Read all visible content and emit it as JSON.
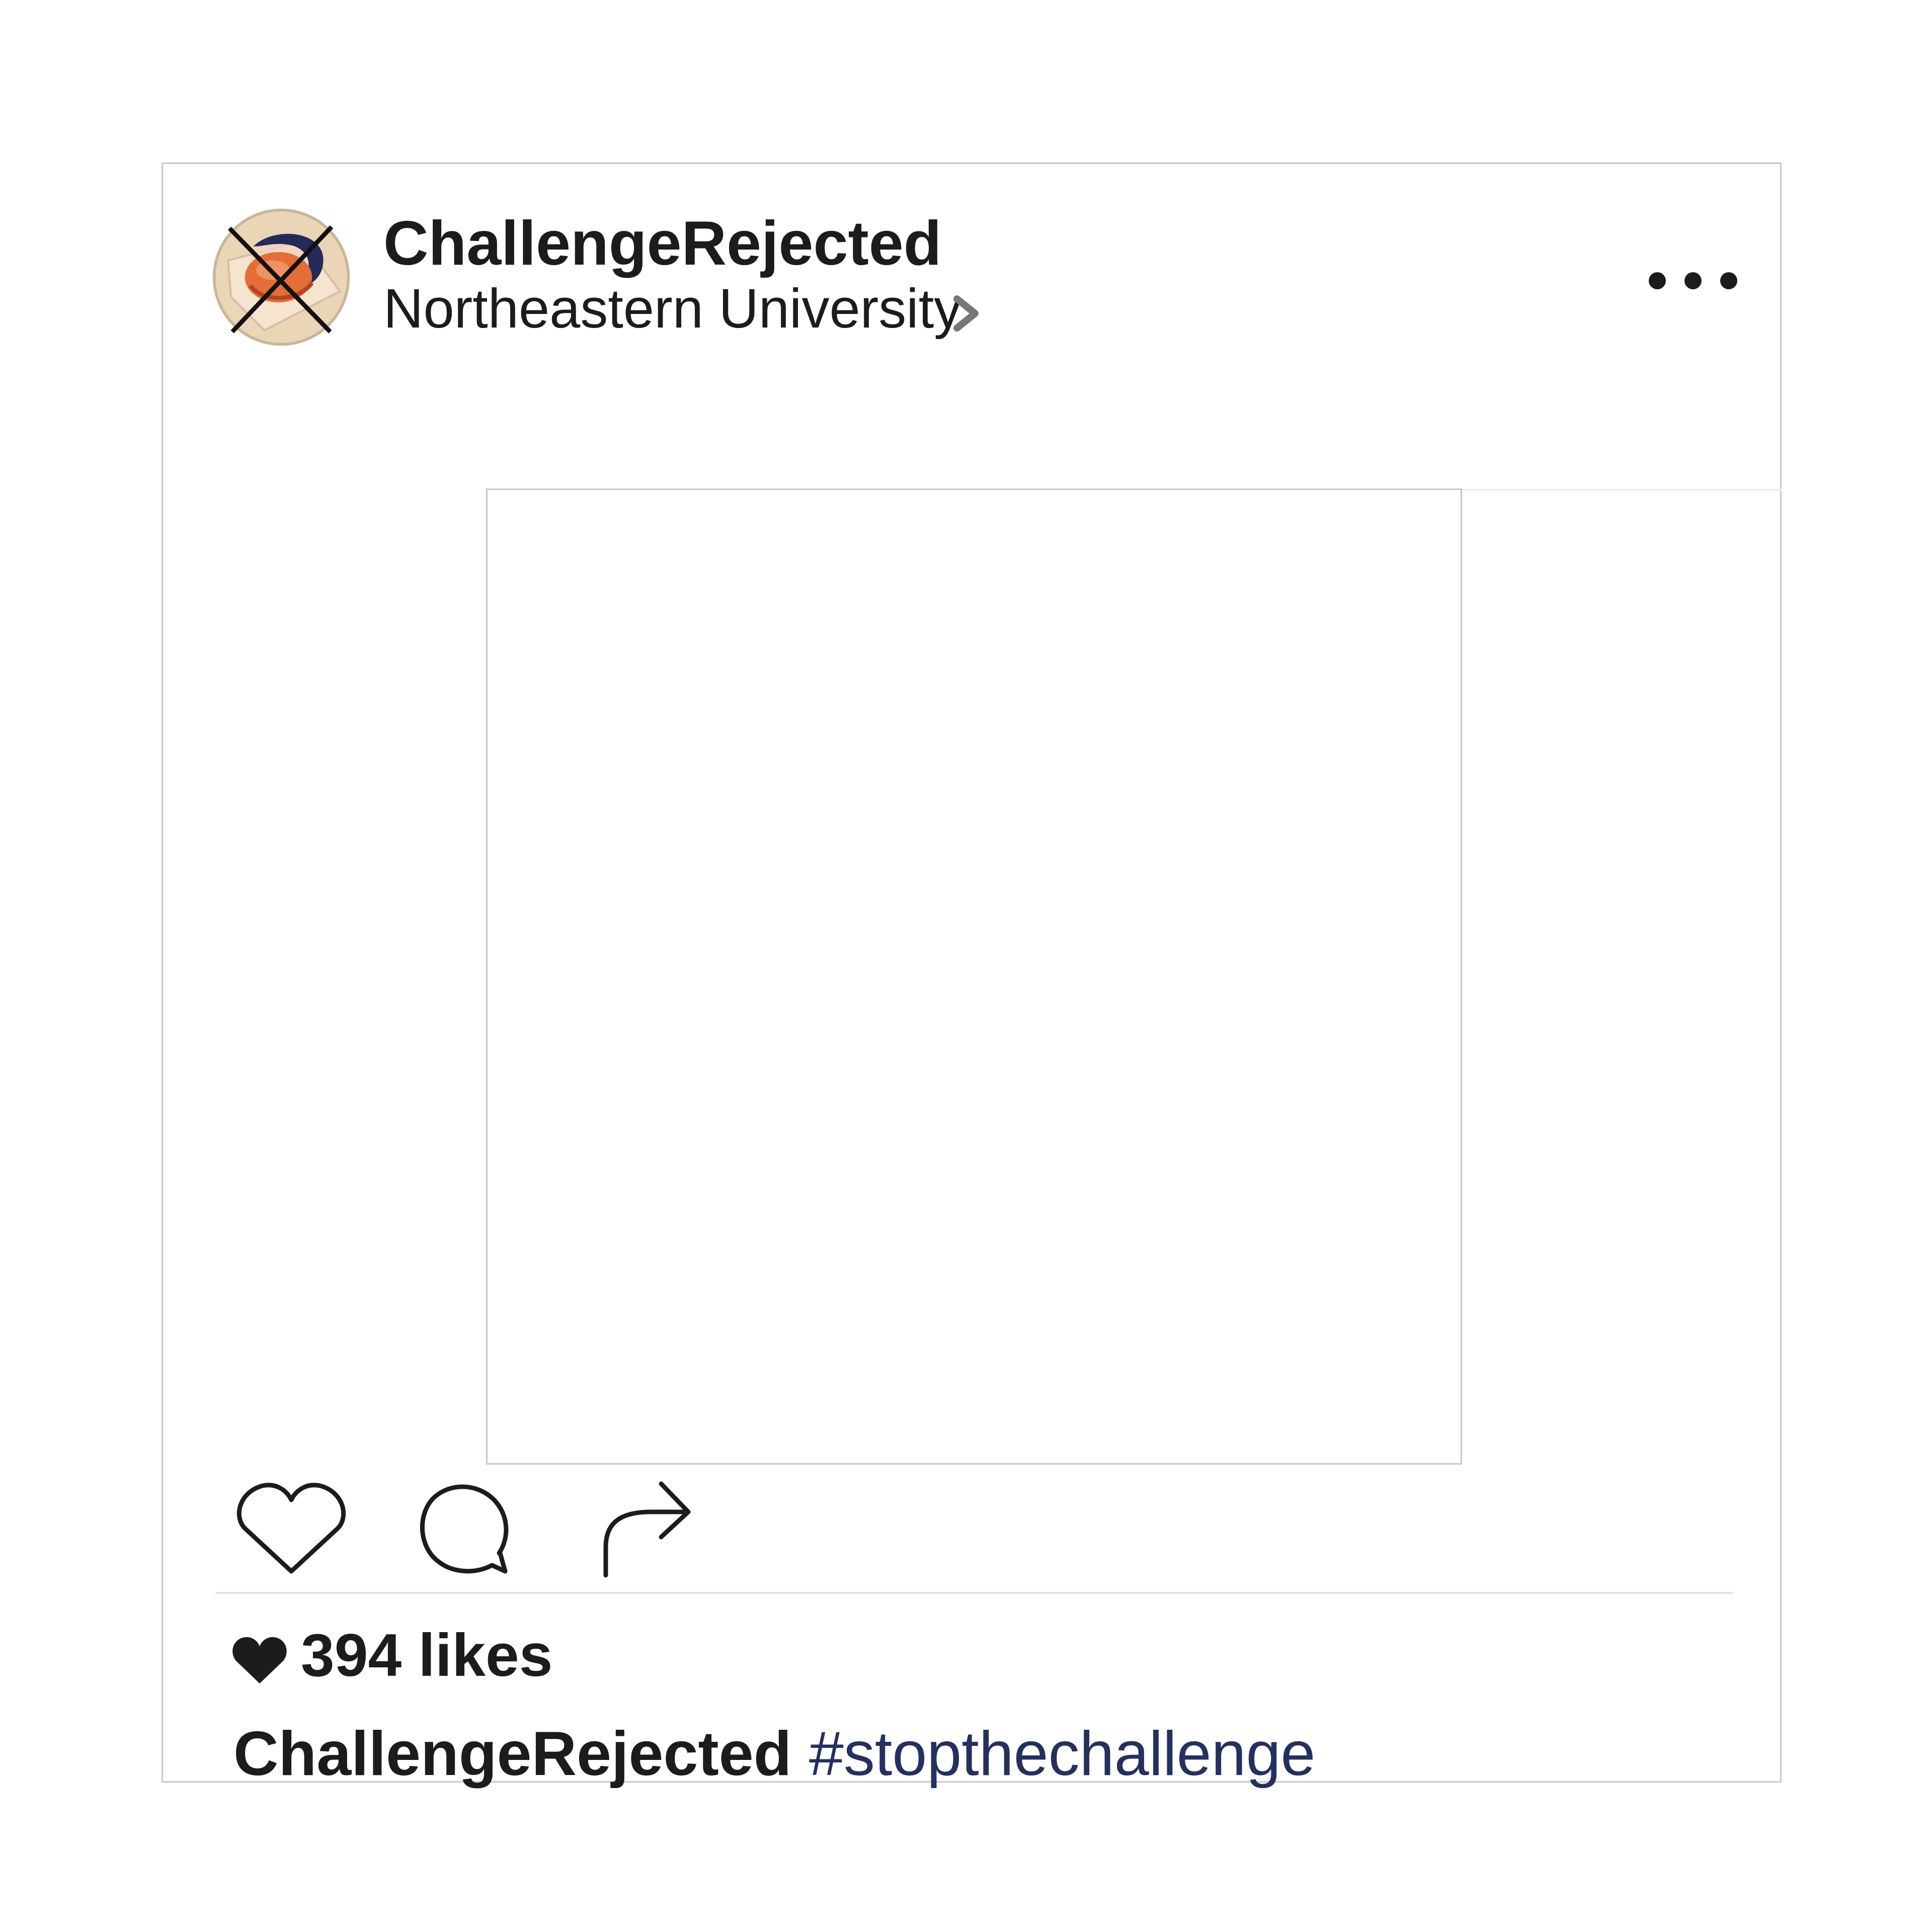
{
  "post": {
    "username": "ChallengeRejected",
    "location": "Northeastern University",
    "likes": "394 likes",
    "caption": {
      "username": "ChallengeRejected",
      "hashtag": "#stopthechallenge"
    }
  },
  "icons": {
    "avatar": "crossed-out-detergent-pod-icon",
    "location": "chevron-right-icon",
    "more": "more-options-icon",
    "like": "heart-outline-icon",
    "comment": "comment-bubble-icon",
    "share": "share-arrow-icon",
    "likes": "heart-filled-icon"
  },
  "colors": {
    "text": "#1c1c1c",
    "hashtag": "#24305e",
    "border": "#c9c9c9",
    "avatar_background": "#ead5b6",
    "pod_orange": "#e46d38",
    "pod_navy": "#242b58"
  }
}
